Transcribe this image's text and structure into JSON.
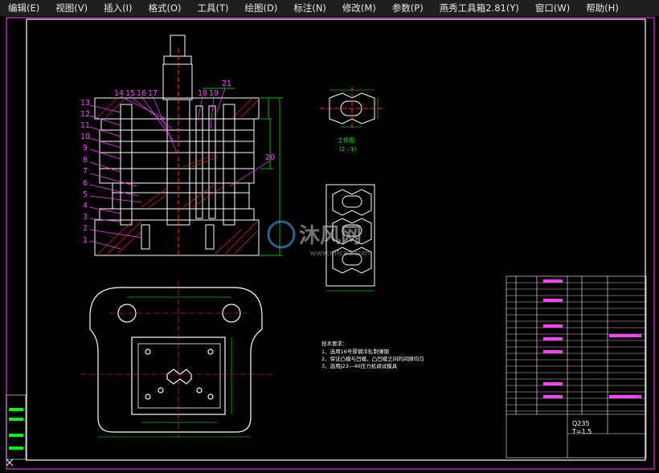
{
  "menus": [
    "编辑(E)",
    "视图(V)",
    "插入(I)",
    "格式(O)",
    "工具(T)",
    "绘图(D)",
    "标注(N)",
    "修改(M)",
    "参数(P)",
    "燕秀工具箱2.81(Y)",
    "窗口(W)",
    "帮助(H)"
  ],
  "part_numbers_left": [
    "13",
    "12",
    "11",
    "10",
    "9",
    "8",
    "7",
    "6",
    "5",
    "4",
    "3",
    "2",
    "1"
  ],
  "part_numbers_top": [
    "14",
    "15",
    "16",
    "17",
    "18",
    "19",
    "21"
  ],
  "part_number_right": "20",
  "workpiece_caption": "工件图",
  "workpiece_scale": "(2 : 1)",
  "tech_req": {
    "title": "技术要求：",
    "lines": [
      "1、选用16号厚钢冷轧制薄钢",
      "2、保证凸模与凹模，凸凹模之间的间隙均匀",
      "3、选用J23—40压力机调试模具"
    ]
  },
  "title_block": {
    "material": "Q235",
    "thickness": "T=1.5"
  },
  "watermark": {
    "brand": "沐风网",
    "url": "www.mfcad.com"
  },
  "colors": {
    "outline": "#ffffff",
    "dim": "#00ff00",
    "part_labels": "#ff44ff",
    "center": "#ff3030",
    "hatch": "#ff3030",
    "frame": "#ff44ff"
  }
}
